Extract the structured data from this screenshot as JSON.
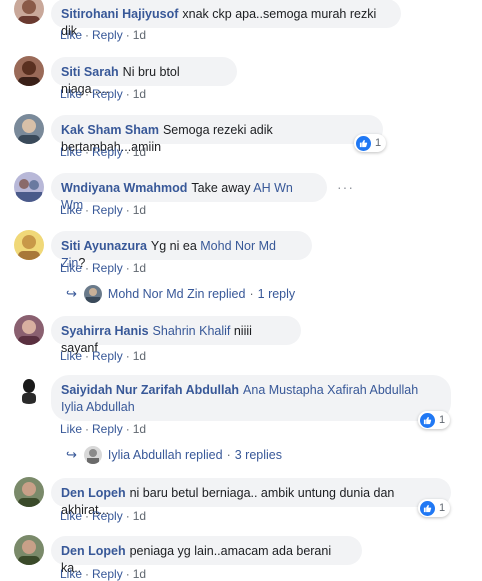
{
  "comments": [
    {
      "author": "Sitirohani Hajiyusof",
      "text": "xnak ckp apa..semoga murah rezki dik",
      "like": "Like",
      "reply": "Reply",
      "time": "1d",
      "avatar_color": "#b08070"
    },
    {
      "author": "Siti Sarah",
      "text": "Ni bru btol niaga.....",
      "like": "Like",
      "reply": "Reply",
      "time": "1d",
      "avatar_color": "#7a4a3a"
    },
    {
      "author": "Kak Sham Sham",
      "text": "Semoga rezeki adik bertambah...amiin",
      "like": "Like",
      "reply": "Reply",
      "time": "1d",
      "reaction_count": "1",
      "avatar_color": "#5a6a7a"
    },
    {
      "author": "Wndiyana Wmahmod",
      "text": "Take away",
      "mention": "AH Wn Wm",
      "like": "Like",
      "reply": "Reply",
      "time": "1d",
      "avatar_color": "#8a8ab0"
    },
    {
      "author": "Siti Ayunazura",
      "text": "Yg ni ea",
      "mention": "Mohd Nor Md Zin",
      "tail": "?",
      "like": "Like",
      "reply": "Reply",
      "time": "1d",
      "avatar_color": "#d8b850",
      "replies": {
        "name": "Mohd Nor Md Zin replied",
        "count": "1 reply"
      }
    },
    {
      "author": "Syahirra Hanis",
      "mention": "Shahrin Khalif",
      "text": "niiii sayanf",
      "like": "Like",
      "reply": "Reply",
      "time": "1d",
      "avatar_color": "#6a4a5a"
    },
    {
      "author": "Saiyidah Nur Zarifah Abdullah",
      "mention": "Ana Mustapha Xafirah Abdullah",
      "mention2": "Iylia Abdullah",
      "like": "Like",
      "reply": "Reply",
      "time": "1d",
      "reaction_count": "1",
      "avatar_color": "#2a2a2a",
      "replies": {
        "name": "Iylia Abdullah replied",
        "count": "3 replies"
      }
    },
    {
      "author": "Den Lopeh",
      "text": "ni baru betul berniaga.. ambik untung dunia dan akhirat...",
      "like": "Like",
      "reply": "Reply",
      "time": "1d",
      "reaction_count": "1",
      "avatar_color": "#4a5a3a"
    },
    {
      "author": "Den Lopeh",
      "text": "peniaga yg lain..amacam ada berani ka..",
      "like": "Like",
      "reply": "Reply",
      "time": "1d",
      "avatar_color": "#4a5a3a"
    }
  ],
  "more_icon": "···",
  "reply_icon": "↪"
}
